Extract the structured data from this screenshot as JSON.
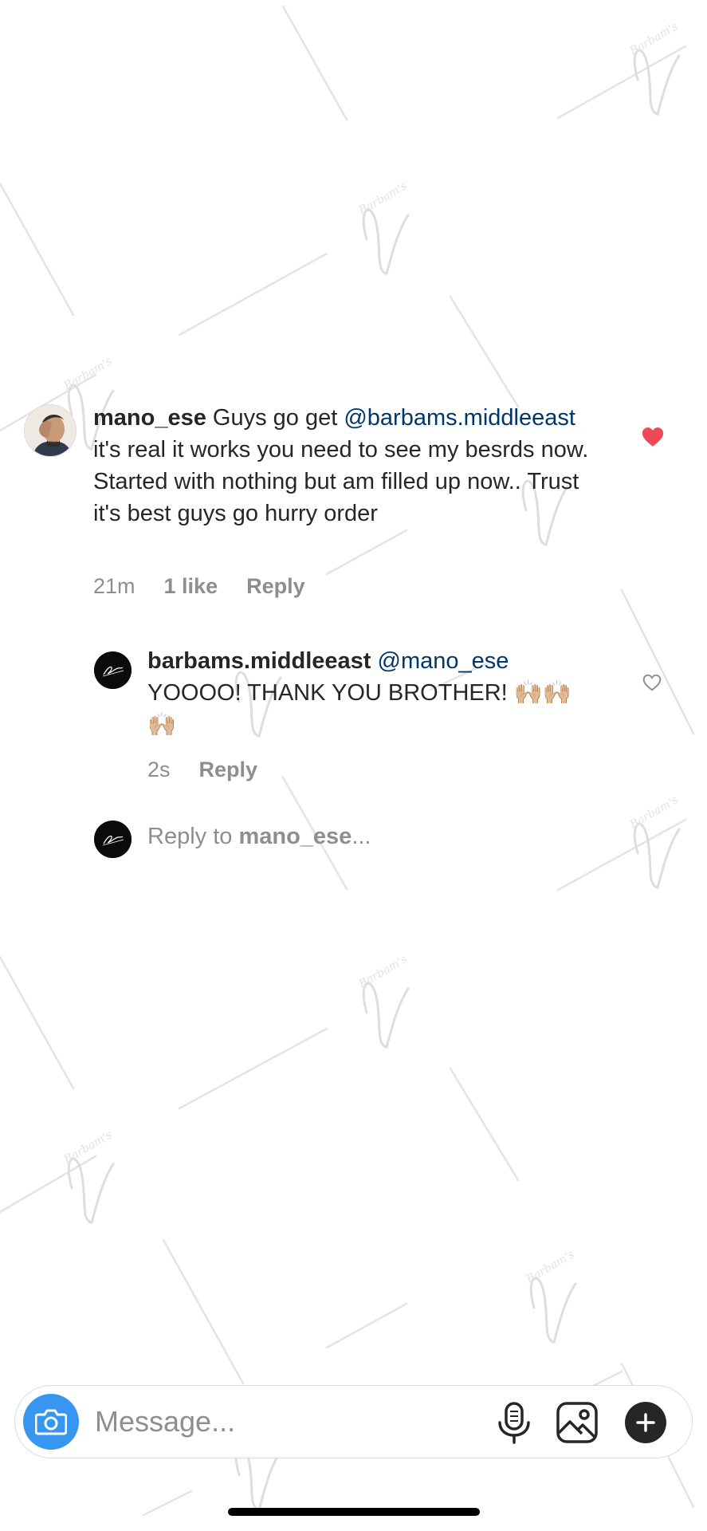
{
  "comment": {
    "username": "mano_ese",
    "text_before_mention": " Guys go get ",
    "mention": "@barbams.middleeast",
    "text_after_mention": " it's real it works you need to see my besrds now. Started with nothing but am filled up now.. Trust it's best guys go hurry order",
    "time": "21m",
    "likes": "1 like",
    "reply_label": "Reply",
    "liked": true,
    "avatar_icon": "profile-photo",
    "heart_icon": "filled-heart-icon",
    "heart_color": "#ed4956"
  },
  "reply": {
    "username": "barbams.middleeast",
    "mention": "@mano_ese",
    "text": "YOOOO! THANK YOU BROTHER! ",
    "emoji": "🙌🏼🙌🏼🙌🏼",
    "time": "2s",
    "reply_label": "Reply",
    "heart_icon": "outline-heart-icon"
  },
  "reply_to": {
    "prefix": "Reply to ",
    "username": "mano_ese",
    "suffix": "..."
  },
  "composer": {
    "placeholder": "Message...",
    "camera_icon": "camera-icon",
    "mic_icon": "microphone-icon",
    "gallery_icon": "gallery-icon",
    "plus_icon": "plus-icon",
    "accent": "#3797f0"
  },
  "watermark": {
    "text": "Barbam's"
  }
}
